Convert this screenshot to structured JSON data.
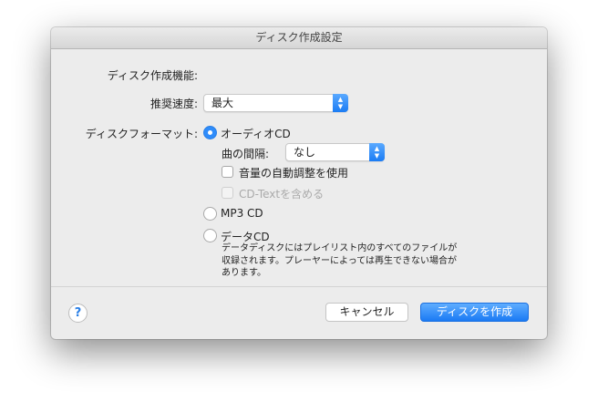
{
  "window": {
    "title": "ディスク作成設定"
  },
  "settings": {
    "section_label": "ディスク作成機能:",
    "speed_label": "推奨速度:",
    "speed_value": "最大",
    "format_label": "ディスクフォーマット:",
    "formats": [
      {
        "label": "オーディオCD",
        "selected": true
      },
      {
        "label": "MP3 CD",
        "selected": false
      },
      {
        "label": "データCD",
        "selected": false
      }
    ],
    "gap_label": "曲の間隔:",
    "gap_value": "なし",
    "sound_check_label": "音量の自動調整を使用",
    "sound_check_checked": false,
    "cd_text_label": "CD-Textを含める",
    "cd_text_checked": false,
    "data_cd_description": "データディスクにはプレイリスト内のすべてのファイルが収録されます。プレーヤーによっては再生できない場合があります。"
  },
  "footer": {
    "help_label": "?",
    "cancel_label": "キャンセル",
    "burn_label": "ディスクを作成"
  },
  "colors": {
    "accent": "#1a7af4"
  }
}
